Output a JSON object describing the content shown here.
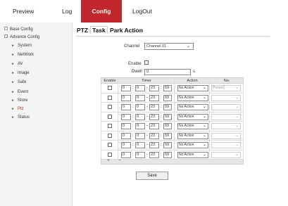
{
  "nav": {
    "preview": "Preview",
    "log": "Log",
    "config": "Config",
    "logout": "LogOut"
  },
  "sidebar": {
    "items": [
      {
        "label": "Base Config"
      },
      {
        "label": "Advance Config"
      },
      {
        "label": "System"
      },
      {
        "label": "NetWork"
      },
      {
        "label": "AV"
      },
      {
        "label": "Image"
      },
      {
        "label": "Safe"
      },
      {
        "label": "Event"
      },
      {
        "label": "Store"
      },
      {
        "label": "Ptz"
      },
      {
        "label": "Status"
      }
    ]
  },
  "tabs": [
    "PTZ",
    "Task",
    "Park Action"
  ],
  "form": {
    "channel_label": "Channel",
    "channel_value": "Channel 01",
    "enable_label": "Enable",
    "dwell_label": "Dwell",
    "dwell_value": "0",
    "dwell_unit": "s"
  },
  "table": {
    "headers": [
      "Enable",
      "Timer",
      "Action",
      "No."
    ],
    "rows": [
      {
        "h1": "0",
        "m1": "0",
        "h2": "23",
        "m2": "59",
        "action": "No Action",
        "no": "Preset1"
      },
      {
        "h1": "0",
        "m1": "0",
        "h2": "23",
        "m2": "59",
        "action": "No Action",
        "no": ""
      },
      {
        "h1": "0",
        "m1": "0",
        "h2": "23",
        "m2": "59",
        "action": "No Action",
        "no": ""
      },
      {
        "h1": "0",
        "m1": "0",
        "h2": "23",
        "m2": "59",
        "action": "No Action",
        "no": ""
      },
      {
        "h1": "0",
        "m1": "0",
        "h2": "23",
        "m2": "59",
        "action": "No Action",
        "no": ""
      },
      {
        "h1": "0",
        "m1": "0",
        "h2": "23",
        "m2": "59",
        "action": "No Action",
        "no": ""
      },
      {
        "h1": "0",
        "m1": "0",
        "h2": "23",
        "m2": "59",
        "action": "No Action",
        "no": ""
      },
      {
        "h1": "0",
        "m1": "0",
        "h2": "23",
        "m2": "59",
        "action": "No Action",
        "no": ""
      }
    ],
    "add_symbol": "+",
    "remove_symbol": "−"
  },
  "save_label": "Save",
  "colors": {
    "accent": "#c0262b"
  }
}
